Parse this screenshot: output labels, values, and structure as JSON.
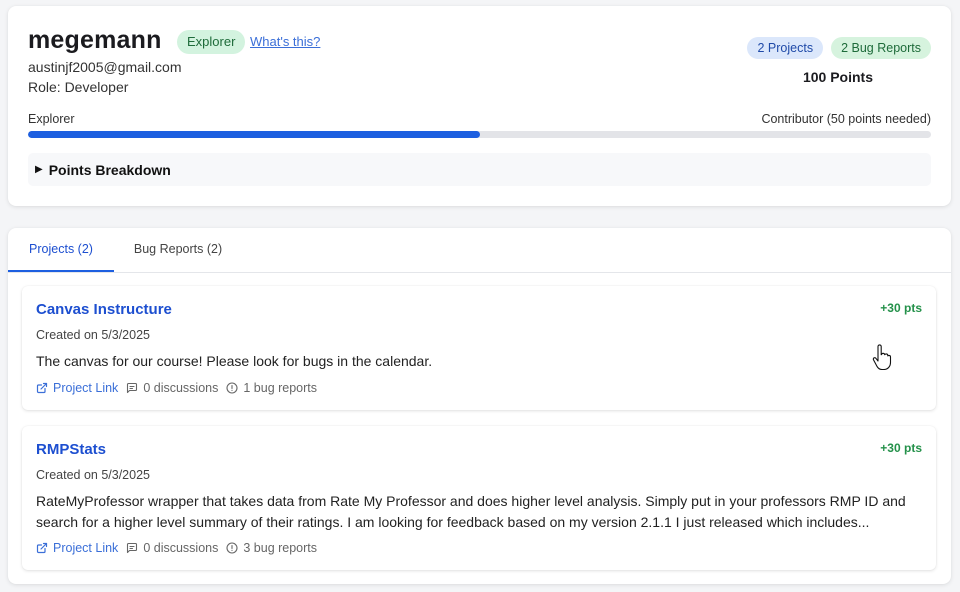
{
  "profile": {
    "username": "megemann",
    "tier_badge": "Explorer",
    "whats_this": "What's this?",
    "email": "austinjf2005@gmail.com",
    "role": "Role: Developer",
    "projects_badge": "2 Projects",
    "bug_reports_badge": "2 Bug Reports",
    "points": "100 Points",
    "current_level": "Explorer",
    "next_level": "Contributor (50 points needed)",
    "progress_fraction": 0.5,
    "points_breakdown_label": "Points Breakdown"
  },
  "tabs": {
    "projects": "Projects (2)",
    "bug_reports": "Bug Reports (2)",
    "active": "projects"
  },
  "projects": [
    {
      "title": "Canvas Instructure",
      "points": "+30 pts",
      "created": "Created on 5/3/2025",
      "description": "The canvas for our course! Please look for bugs in the calendar.",
      "link_label": "Project Link",
      "discussions": "0 discussions",
      "bug_reports": "1 bug reports"
    },
    {
      "title": "RMPStats",
      "points": "+30 pts",
      "created": "Created on 5/3/2025",
      "description": "RateMyProfessor wrapper that takes data from Rate My Professor and does higher level analysis. Simply put in your professors RMP ID and search for a higher level summary of their ratings. I am looking for feedback based on my version 2.1.1 I just released which includes...",
      "link_label": "Project Link",
      "discussions": "0 discussions",
      "bug_reports": "3 bug reports"
    }
  ],
  "colors": {
    "accent": "#1d5fe0",
    "link": "#3b6fd8",
    "points_green": "#24914a",
    "badge_green_bg": "#d3f3df",
    "badge_blue_bg": "#dbe7fb"
  },
  "icons": {
    "external_link": "external-link-icon",
    "discussion": "comment-icon",
    "bug": "alert-circle-icon",
    "cursor": "hand-pointer-icon",
    "disclosure": "triangle-right-icon"
  }
}
